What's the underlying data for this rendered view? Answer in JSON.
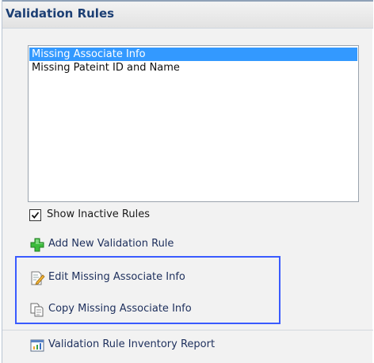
{
  "header": {
    "title": "Validation Rules"
  },
  "rules_list": {
    "items": [
      {
        "label": "Missing Associate Info",
        "selected": true
      },
      {
        "label": "Missing Pateint ID and Name",
        "selected": false
      }
    ]
  },
  "show_inactive": {
    "label": "Show Inactive Rules",
    "checked": true
  },
  "actions": {
    "add_label": "Add New Validation Rule",
    "edit_label": "Edit Missing Associate Info",
    "copy_label": "Copy Missing Associate Info",
    "report_label": "Validation Rule Inventory Report"
  },
  "icons": {
    "add": "plus-icon",
    "edit": "edit-document-icon",
    "copy": "copy-document-icon",
    "report": "report-chart-icon"
  },
  "colors": {
    "title": "#1c3f74",
    "selection": "#3399ff",
    "highlight_box": "#3a5bff",
    "add_icon": "#2fa82f"
  }
}
